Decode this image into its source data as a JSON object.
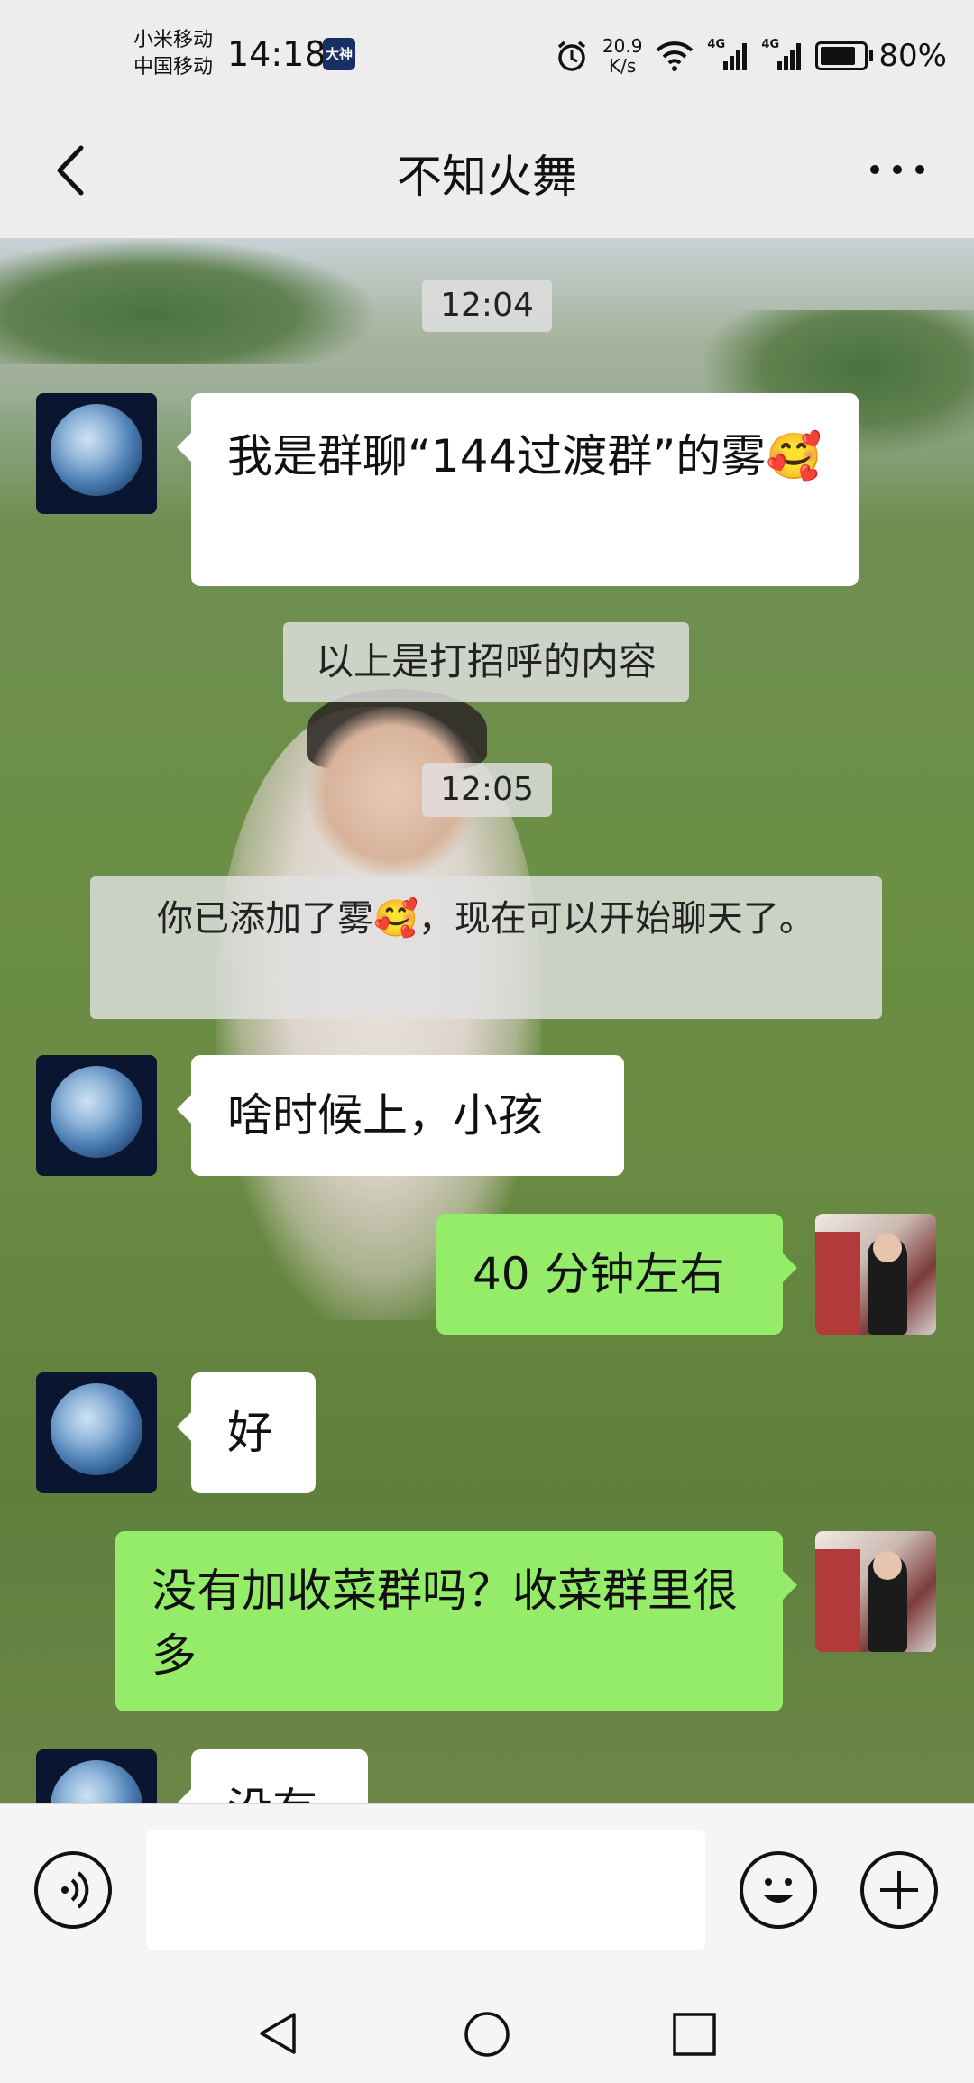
{
  "status_bar": {
    "carrier_line1": "小米移动",
    "carrier_line2": "中国移动",
    "time": "14:18",
    "app_icon_label": "大神",
    "net_speed_value": "20.9",
    "net_speed_unit": "K/s",
    "signal1_label": "4G",
    "signal2_label": "4G",
    "battery": "80%"
  },
  "header": {
    "title": "不知火舞",
    "more_label": "..."
  },
  "messages": {
    "stamp_1": "12:04",
    "msg_1": "我是群聊“144过渡群”的雾🥰",
    "system_1": "以上是打招呼的内容",
    "stamp_2": "12:05",
    "system_2": "你已添加了雾🥰，现在可以开始聊天了。",
    "msg_2": "啥时候上，小孩",
    "msg_3": "40 分钟左右",
    "msg_4": "好",
    "msg_5": "没有加收菜群吗？收菜群里很多",
    "msg_6": "没有"
  },
  "colors": {
    "chat_bubble_mine": "#95ec69",
    "chat_bubble_theirs": "#ffffff",
    "bar_background": "#ededed"
  },
  "icons": {
    "back": "chevron-left-icon",
    "voice": "voice-icon",
    "emoji": "emoji-icon",
    "plus": "plus-icon"
  }
}
